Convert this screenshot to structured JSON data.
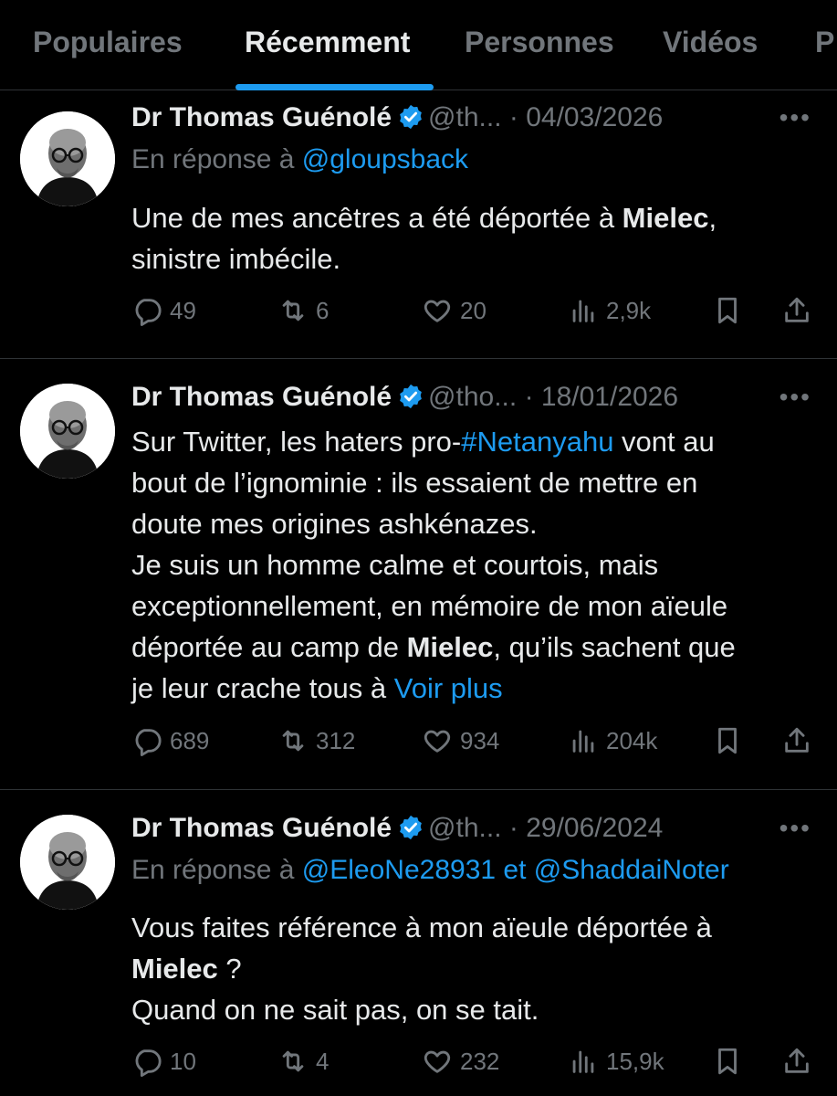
{
  "tabs": [
    "Populaires",
    "Récemment",
    "Personnes",
    "Vidéos",
    "P"
  ],
  "colors": {
    "accent": "#1d9bf0",
    "muted": "#71767b",
    "text": "#e7e9ea",
    "divider": "#2f3336"
  },
  "tweets": [
    {
      "name": "Dr Thomas Guénolé",
      "handle": "@th...",
      "dot": "·",
      "date": "04/03/2026",
      "reply_prefix": "En réponse à ",
      "reply_to": "@gloupsback",
      "reply_and": "",
      "reply_to2": "",
      "text": [
        {
          "t": "Une de mes ancêtres a été déportée à "
        },
        {
          "t": "Mielec",
          "b": true
        },
        {
          "t": ",\nsinistre imbécile."
        }
      ],
      "replies": "49",
      "reposts": "6",
      "likes": "20",
      "views": "2,9k"
    },
    {
      "name": "Dr Thomas Guénolé",
      "handle": "@tho...",
      "dot": "·",
      "date": "18/01/2026",
      "text": [
        {
          "t": "Sur Twitter, les haters pro-"
        },
        {
          "t": "#Netanyahu",
          "l": true
        },
        {
          "t": " vont au\nbout de l’ignominie : ils essaient de mettre en\ndoute mes origines ashkénazes.\nJe suis un homme calme et courtois, mais\nexceptionnellement, en mémoire de mon aïeule\ndéportée au camp de "
        },
        {
          "t": "Mielec",
          "b": true
        },
        {
          "t": ", qu’ils sachent que\nje leur crache tous à "
        },
        {
          "t": "Voir plus",
          "l": true
        }
      ],
      "replies": "689",
      "reposts": "312",
      "likes": "934",
      "views": "204k"
    },
    {
      "name": "Dr Thomas Guénolé",
      "handle": "@th...",
      "dot": "·",
      "date": "29/06/2024",
      "reply_prefix": "En réponse à ",
      "reply_to": "@EleoNe28931",
      "reply_and": " et ",
      "reply_to2": "@ShaddaiNoter",
      "text": [
        {
          "t": "Vous faites référence à mon aïeule déportée à\n"
        },
        {
          "t": "Mielec",
          "b": true
        },
        {
          "t": " ?\nQuand on ne sait pas, on se tait."
        }
      ],
      "replies": "10",
      "reposts": "4",
      "likes": "232",
      "views": "15,9k"
    }
  ]
}
